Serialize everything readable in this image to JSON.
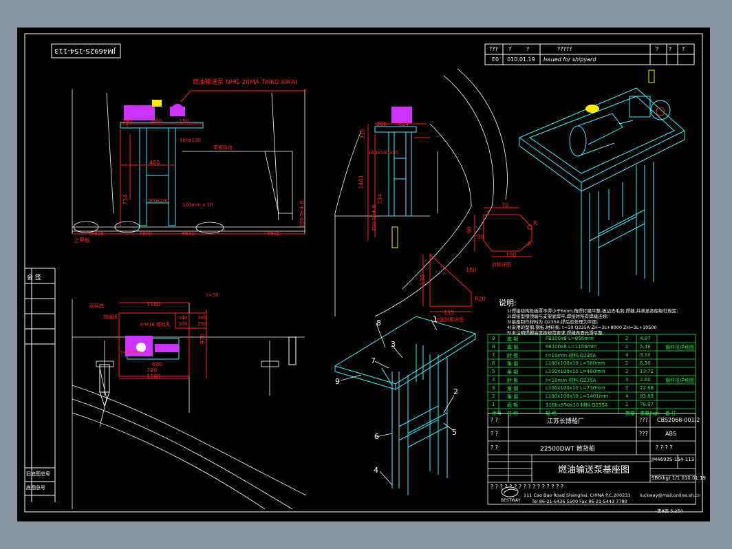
{
  "drawing_no_rotated": "JM4692S-154-113",
  "revision_table": {
    "header": [
      "???",
      "?",
      "?",
      "?????",
      "?",
      "?",
      "?",
      "?"
    ],
    "row": {
      "mark": "E0",
      "date": "010.01.19",
      "desc": "Issued for shipyard"
    }
  },
  "side_labels": {
    "sign": "会 签",
    "cell1": "旧底图总号",
    "cell2": "底图总号"
  },
  "front_view": {
    "title_label": "燃油输送泵 NHG-20MA TAIKO KIKAI",
    "dims": [
      "200",
      "460",
      "150",
      "460",
      "734"
    ],
    "frames": [
      "FR28",
      "FR29",
      "FR30",
      "FR32"
    ],
    "deck_label": "上甲板",
    "notes": [
      "甲板纵骨",
      "100x100",
      "200x200",
      "100mm x 10",
      "100x100 8mm"
    ],
    "right_dim": "250 Tank B."
  },
  "side_view": {
    "dims": [
      "380",
      "634",
      "210",
      "1401",
      "734"
    ],
    "notes": [
      "160x100x10",
      "100 Tank B."
    ]
  },
  "plan_view": {
    "dims": [
      "1160",
      "1160",
      "790",
      "600",
      "970",
      "340",
      "305",
      "300",
      "230"
    ],
    "notes": [
      "双层底",
      "加强板",
      "4-M16 螺栓孔",
      "t=10",
      "t=10mm"
    ]
  },
  "bracket_detail": {
    "dims": [
      "70",
      "90",
      "R",
      "100",
      "R",
      "30"
    ],
    "label": "肘板详图"
  },
  "knee_detail": {
    "dims": [
      "180",
      "135",
      "130",
      "R20"
    ],
    "label": "加强肘板详图"
  },
  "notes": {
    "heading": "说明:",
    "lines": [
      "1)焊接结构处板厚不得小于6mm,角焊打磨平整,板边去毛刺,焊缝,并满足各船级社规定;",
      "2)焊接型钢顶端与支架底焊牢,焊接时所有焊缝连续;",
      "3)基座制作材料为 Q235A,焊后应处理为平面;",
      "4)采用的型钢,钢板,材料表:  t=10 Q235A  ZH=3L+8000  ZH=3L+10500",
      "5)未注明焊脚高度按规范要求,焊缝表面光滑平整."
    ]
  },
  "parts_table": {
    "rows": [
      {
        "no": "9",
        "name": "扁 钢",
        "spec": "FB100x8 L=856mm",
        "qty": "2",
        "wt": "4.87",
        "rem": ""
      },
      {
        "no": "8",
        "name": "扁 钢",
        "spec": "FB100x8 L=1156mm",
        "qty": "2",
        "wt": "5.48",
        "rem": "钢件见详细图"
      },
      {
        "no": "7",
        "name": "肘 板",
        "spec": "t=10mm 材料:Q235A",
        "qty": "4",
        "wt": "3.10",
        "rem": ""
      },
      {
        "no": "6",
        "name": "角 钢",
        "spec": "L100x100x10 L=580mm",
        "qty": "2",
        "wt": "6.30",
        "rem": ""
      },
      {
        "no": "5",
        "name": "角 钢",
        "spec": "L100x100x10 L=460mm",
        "qty": "2",
        "wt": "13.72",
        "rem": ""
      },
      {
        "no": "4",
        "name": "肘 板",
        "spec": "t=10mm 材料:Q235A",
        "qty": "4",
        "wt": "2.60",
        "rem": "钢件见详细图"
      },
      {
        "no": "3",
        "name": "角 钢",
        "spec": "L100x100x10 L=730mm",
        "qty": "2",
        "wt": "22.68",
        "rem": ""
      },
      {
        "no": "2",
        "name": "角 钢",
        "spec": "L100x100x10 L=1401mm",
        "qty": "4",
        "wt": "83.89",
        "rem": ""
      },
      {
        "no": "1",
        "name": "面 板",
        "spec": "1160x970x10 材料:Q235A",
        "qty": "1",
        "wt": "78.97",
        "rem": ""
      }
    ],
    "header": {
      "no": "序号",
      "name": "名 称",
      "spec": "规 格",
      "qty": "数量",
      "wt": "重量(kg)",
      "rem": "备 注"
    }
  },
  "title_block": {
    "yard_label": "? ?",
    "yard": "江苏长博船厂",
    "yard_code_label": "???",
    "yard_code": "CBS2068-001/2",
    "ship_label": "? ?",
    "class_label": "???",
    "class": "ABS",
    "vessel_label": "? ?",
    "vessel": "22500DWT 散货船",
    "vessel_q": "? ? ? ?",
    "title": "燃油输送泵基座图",
    "dwg_no": "JM4692S-154-113",
    "sheet_scale": "SB0(kg) 1/1 010.01.19",
    "q_line": "? ? ? ? ? ? ? ? ? ? ? ? ? ? ? ?",
    "company": "BESTWAY",
    "address": "111 Cao Bao Road Shanghai, CHINA  P.C.200233",
    "tel": "Tel 86-21-6436 5500  Fax 86-21-5443 7780",
    "email": "luckway@mail.online.sh.cn",
    "page": "第8页  5.254"
  },
  "iso_callouts": [
    "1",
    "2",
    "3",
    "4",
    "5",
    "6",
    "7",
    "8",
    "9"
  ],
  "colors": {
    "line": "#ffffff",
    "cyan": "#44eeff",
    "green": "#22ee44",
    "red": "#ff2222",
    "magenta": "#cc33ff",
    "yellow": "#ffee00",
    "bg": "#000000",
    "frame": "#8d97a6"
  }
}
